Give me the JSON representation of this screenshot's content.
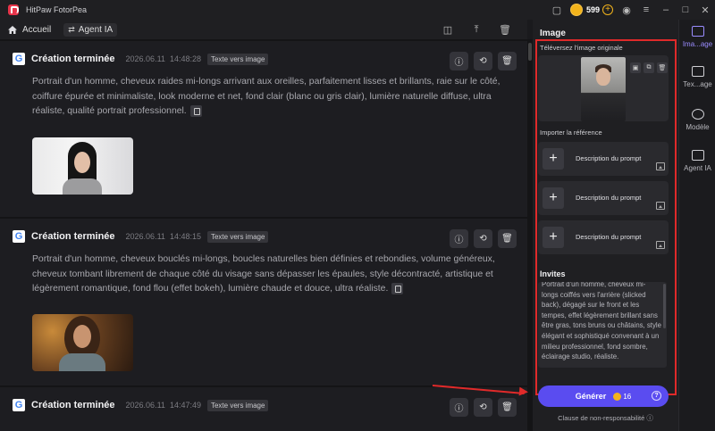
{
  "app": {
    "title": "HitPaw FotorPea",
    "coins": "599"
  },
  "toolbar": {
    "home_label": "Accueil",
    "agent_label": "Agent IA"
  },
  "cards": [
    {
      "title": "Création terminée",
      "date": "2026.06.11",
      "time": "14:48:28",
      "tag": "Texte vers image",
      "text": "Portrait d'un homme, cheveux raides mi-longs arrivant aux oreilles, parfaitement lisses et brillants, raie sur le côté, coiffure épurée et minimaliste, look moderne et net, fond clair (blanc ou gris clair), lumière naturelle diffuse, ultra réaliste, qualité portrait professionnel."
    },
    {
      "title": "Création terminée",
      "date": "2026.06.11",
      "time": "14:48:15",
      "tag": "Texte vers image",
      "text": "Portrait d'un homme, cheveux bouclés mi-longs, boucles naturelles bien définies et rebondies, volume généreux, cheveux tombant librement de chaque côté du visage sans dépasser les épaules, style décontracté, artistique et légèrement romantique, fond flou (effet bokeh), lumière chaude et douce, ultra réaliste."
    },
    {
      "title": "Création terminée",
      "date": "2026.06.11",
      "time": "14:47:49",
      "tag": "Texte vers image",
      "text": ""
    }
  ],
  "panel": {
    "title": "Image",
    "upload_label": "Téléversez l'image originale",
    "import_label": "Importer la référence",
    "prompt_cards": [
      "Description du prompt",
      "Description du prompt",
      "Description du prompt"
    ],
    "invites_label": "Invites",
    "invites_text": "Portrait d'un homme, cheveux mi-longs coiffés vers l'arrière (slicked back), dégagé sur le front et les tempes, effet légèrement brillant sans être gras, tons bruns ou châtains, style élégant et sophistiqué convenant à un milieu professionnel, fond sombre, éclairage studio, réaliste.",
    "generate_label": "Générer",
    "generate_cost": "16",
    "disclaimer": "Clause de non-responsabilité ⓘ"
  },
  "sidenav": [
    {
      "label": "Ima...age",
      "active": true
    },
    {
      "label": "Tex...age",
      "active": false
    },
    {
      "label": "Modèle",
      "active": false
    },
    {
      "label": "Agent IA",
      "active": false
    }
  ],
  "colors": {
    "accent": "#5a4cf0",
    "highlight": "#e02a2a",
    "coin": "#f2b31b"
  }
}
